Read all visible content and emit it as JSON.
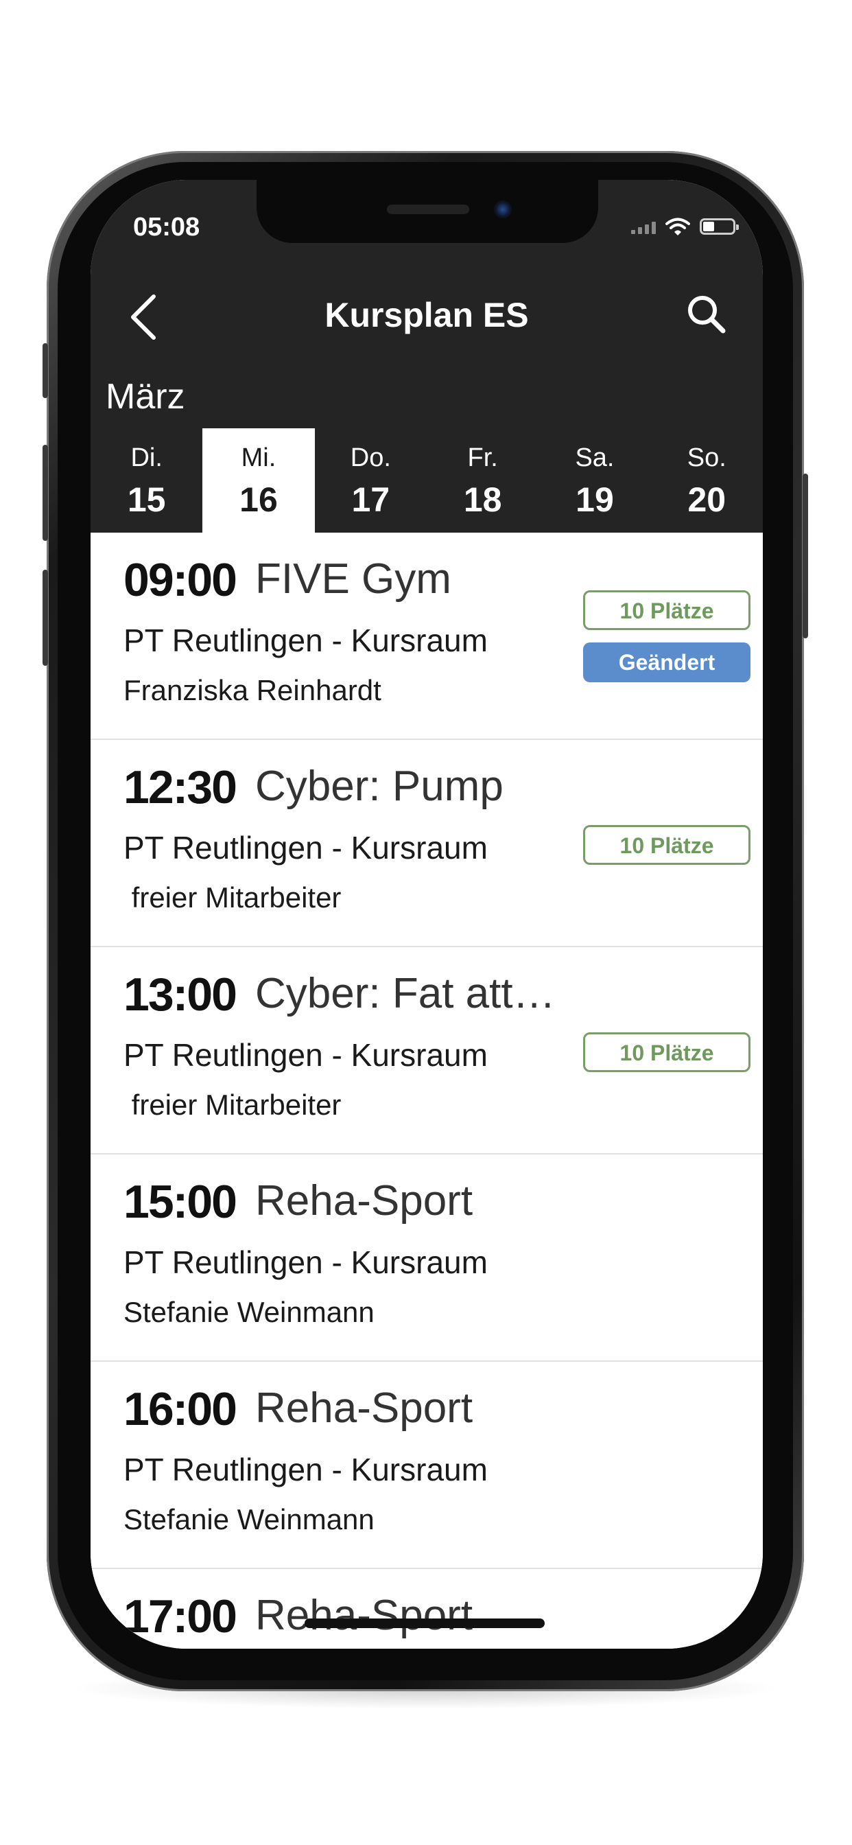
{
  "status_bar": {
    "time": "05:08",
    "signal_icon": "signal-icon",
    "wifi_icon": "wifi-icon",
    "battery_icon": "battery-icon"
  },
  "header": {
    "title": "Kursplan ES",
    "back_icon": "chevron-left-icon",
    "search_icon": "search-icon",
    "month": "März"
  },
  "days": [
    {
      "name": "Di.",
      "num": "15"
    },
    {
      "name": "Mi.",
      "num": "16"
    },
    {
      "name": "Do.",
      "num": "17"
    },
    {
      "name": "Fr.",
      "num": "18"
    },
    {
      "name": "Sa.",
      "num": "19"
    },
    {
      "name": "So.",
      "num": "20"
    }
  ],
  "selected_day": "16",
  "classes": [
    {
      "time": "09:00",
      "title": "FIVE Gym",
      "room": "PT Reutlingen - Kursraum",
      "trainer": "Franziska Reinhardt",
      "places": "10 Plätze",
      "changed": "Geändert"
    },
    {
      "time": "12:30",
      "title": "Cyber: Pump",
      "room": "PT Reutlingen - Kursraum",
      "trainer": " freier Mitarbeiter",
      "places": "10 Plätze"
    },
    {
      "time": "13:00",
      "title": "Cyber: Fat att…",
      "room": "PT Reutlingen - Kursraum",
      "trainer": " freier Mitarbeiter",
      "places": "10 Plätze"
    },
    {
      "time": "15:00",
      "title": "Reha-Sport",
      "room": "PT Reutlingen - Kursraum",
      "trainer": "Stefanie Weinmann"
    },
    {
      "time": "16:00",
      "title": "Reha-Sport",
      "room": "PT Reutlingen - Kursraum",
      "trainer": "Stefanie Weinmann"
    },
    {
      "time": "17:00",
      "title": "Reha-Sport"
    }
  ],
  "colors": {
    "header_bg": "#242424",
    "places_green": "#6f9a5e",
    "changed_blue": "#5b8ccb"
  }
}
